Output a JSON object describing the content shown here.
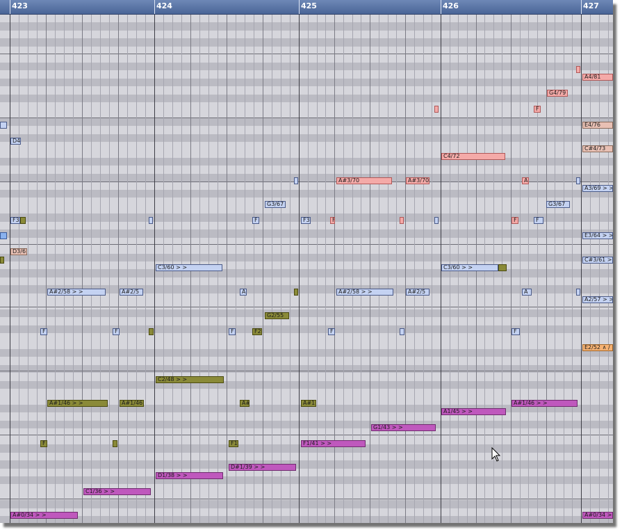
{
  "ruler": {
    "bars": [
      "423",
      "424",
      "425",
      "426",
      "427"
    ]
  },
  "colors": {
    "ruler": "#4a6597",
    "grid_white_key": "#d6d6dc",
    "grid_black_key": "#bbbbc3",
    "note_blue": "#c4d2f2",
    "note_pink": "#f4aaa8",
    "note_olive": "#8a8a38",
    "note_magenta": "#bf58bd",
    "note_orange": "#f6b273"
  },
  "notes": [
    {
      "label": "",
      "color": "pink"
    },
    {
      "label": "A4/81",
      "color": "pink"
    },
    {
      "label": "G4/79",
      "color": "pink"
    },
    {
      "label": "",
      "color": "pink"
    },
    {
      "label": "F",
      "color": "pink"
    },
    {
      "label": "",
      "color": "blue"
    },
    {
      "label": "E4/76",
      "color": "tan"
    },
    {
      "label": "D4",
      "color": "blue"
    },
    {
      "label": "C#4/73",
      "color": "tan"
    },
    {
      "label": "C4/72",
      "color": "pink"
    },
    {
      "label": "",
      "color": "blue"
    },
    {
      "label": "A#3/70",
      "color": "pink"
    },
    {
      "label": "A#3/70",
      "color": "pink"
    },
    {
      "label": "A",
      "color": "pink"
    },
    {
      "label": "",
      "color": "blue"
    },
    {
      "label": "A3/69 > >",
      "color": "blue"
    },
    {
      "label": "G3/67",
      "color": "blue"
    },
    {
      "label": "G3/67",
      "color": "blue"
    },
    {
      "label": "F3",
      "color": "blue"
    },
    {
      "label": "",
      "color": "olive"
    },
    {
      "label": "",
      "color": "blue"
    },
    {
      "label": "F",
      "color": "blue"
    },
    {
      "label": "F3",
      "color": "blue"
    },
    {
      "label": "F",
      "color": "pink"
    },
    {
      "label": "",
      "color": "pink"
    },
    {
      "label": "",
      "color": "blue"
    },
    {
      "label": "F",
      "color": "pink"
    },
    {
      "label": "F",
      "color": "blue"
    },
    {
      "label": "",
      "color": "blue-solid"
    },
    {
      "label": "E3/64 > >",
      "color": "blue"
    },
    {
      "label": "D3/6",
      "color": "tan"
    },
    {
      "label": "",
      "color": "olive"
    },
    {
      "label": "C#3/61 > >",
      "color": "blue"
    },
    {
      "label": "C3/60 > >",
      "color": "blue"
    },
    {
      "label": "C3/60 > >",
      "color": "blue"
    },
    {
      "label": "",
      "color": "olive"
    },
    {
      "label": "A#2/58 > >",
      "color": "blue"
    },
    {
      "label": "A#2/5",
      "color": "blue"
    },
    {
      "label": "A",
      "color": "blue"
    },
    {
      "label": "",
      "color": "olive"
    },
    {
      "label": "A#2/58 > >",
      "color": "blue"
    },
    {
      "label": "A#2/5",
      "color": "blue"
    },
    {
      "label": "A",
      "color": "blue"
    },
    {
      "label": "",
      "color": "blue"
    },
    {
      "label": "A2/57 > >",
      "color": "blue"
    },
    {
      "label": "G2/55",
      "color": "olive"
    },
    {
      "label": "F",
      "color": "blue"
    },
    {
      "label": "F",
      "color": "blue"
    },
    {
      "label": "",
      "color": "olive"
    },
    {
      "label": "F",
      "color": "blue"
    },
    {
      "label": "F2",
      "color": "olive"
    },
    {
      "label": "F",
      "color": "blue"
    },
    {
      "label": "",
      "color": "blue"
    },
    {
      "label": "F",
      "color": "blue"
    },
    {
      "label": "E2/52 ∧ ∕",
      "color": "orange"
    },
    {
      "label": "C2/48 > >",
      "color": "olive"
    },
    {
      "label": "A#1/46 > >",
      "color": "olive"
    },
    {
      "label": "A#1/46",
      "color": "olive"
    },
    {
      "label": "A#",
      "color": "olive"
    },
    {
      "label": "A#1",
      "color": "olive"
    },
    {
      "label": "A#1/46 > >",
      "color": "magenta"
    },
    {
      "label": "A1/45 > >",
      "color": "magenta"
    },
    {
      "label": "G1/43 > >",
      "color": "magenta"
    },
    {
      "label": "F",
      "color": "olive"
    },
    {
      "label": "",
      "color": "olive"
    },
    {
      "label": "F1",
      "color": "olive"
    },
    {
      "label": "F1/41 > >",
      "color": "magenta"
    },
    {
      "label": "D#1/39 > >",
      "color": "magenta"
    },
    {
      "label": "D1/38 > >",
      "color": "magenta"
    },
    {
      "label": "C1/36 > >",
      "color": "magenta"
    },
    {
      "label": "A#0/34 > >",
      "color": "magenta"
    },
    {
      "label": "A#0/34 > >",
      "color": "magenta"
    }
  ]
}
